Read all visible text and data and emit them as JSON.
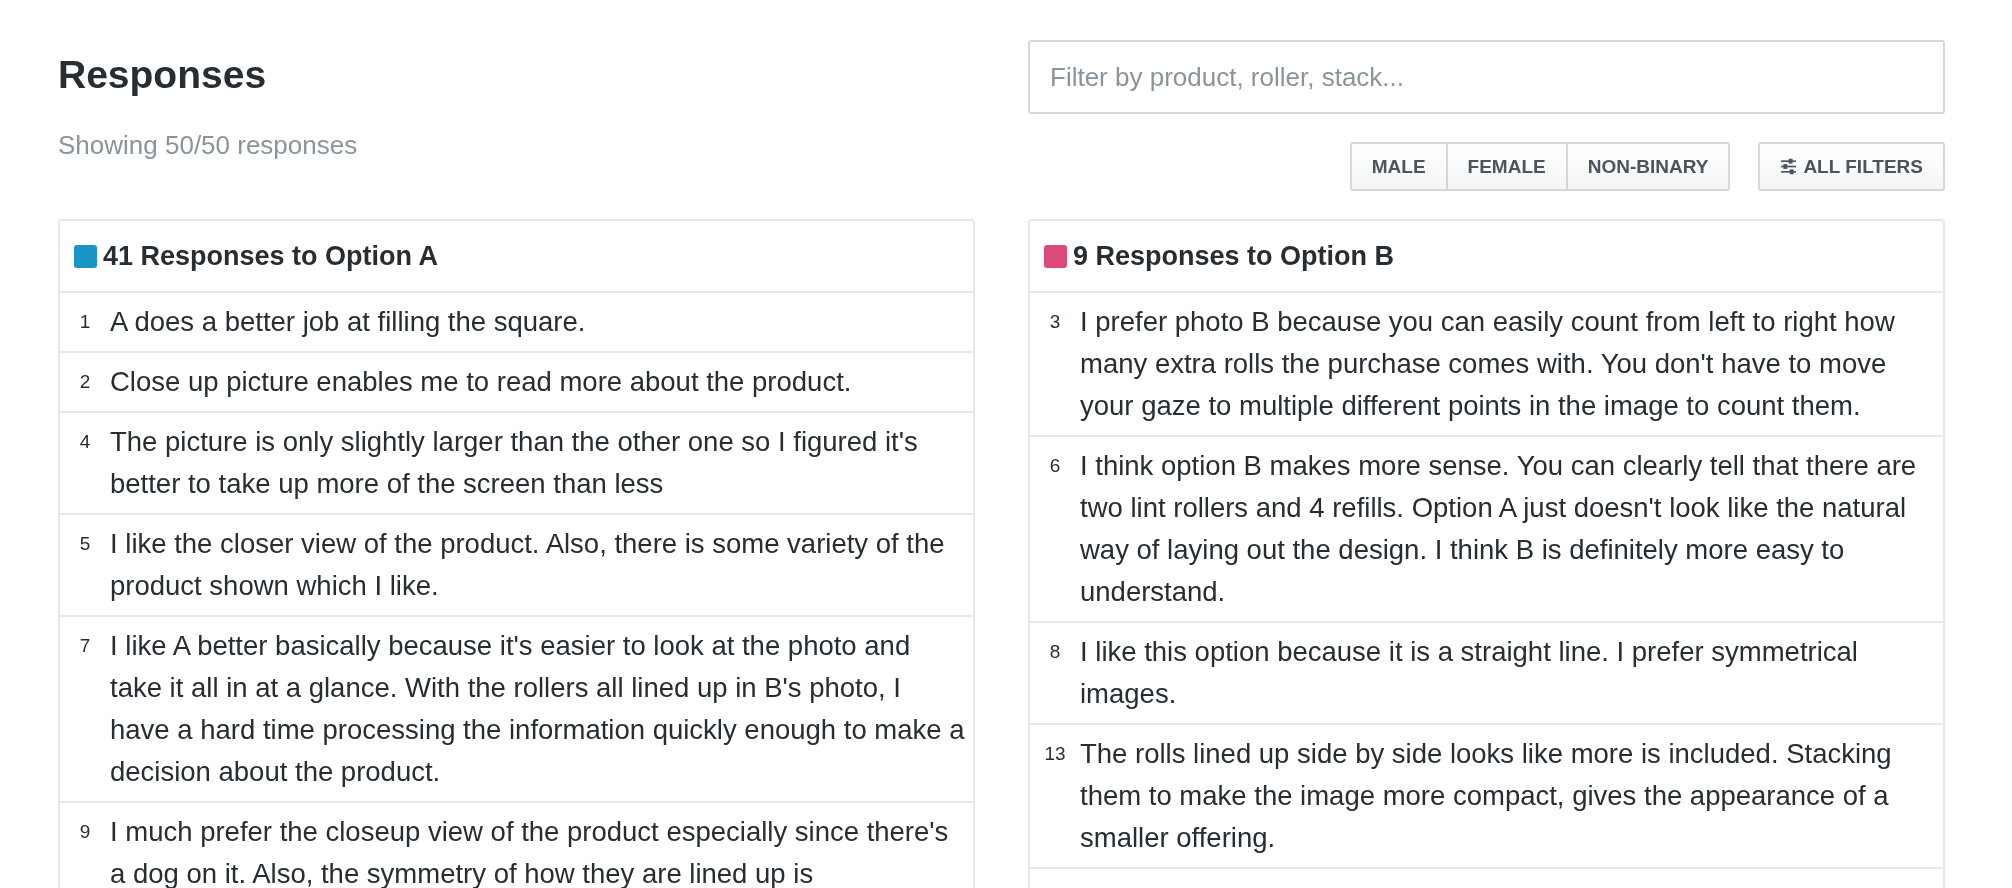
{
  "header": {
    "title": "Responses",
    "subtitle": "Showing 50/50 responses"
  },
  "search": {
    "placeholder": "Filter by product, roller, stack..."
  },
  "gender_filters": [
    {
      "label": "MALE",
      "selected": false
    },
    {
      "label": "FEMALE",
      "selected": false
    },
    {
      "label": "NON-BINARY",
      "selected": false
    }
  ],
  "all_filters_button": {
    "label": "ALL FILTERS"
  },
  "groups": [
    {
      "title": "41 Responses to Option A",
      "color": "#1a96c6",
      "responses": [
        {
          "number": "1",
          "text": "A does a better job at filling the square."
        },
        {
          "number": "2",
          "text": "Close up picture enables me to read more about the product."
        },
        {
          "number": "4",
          "text": "The picture is only slightly larger than the other one so I figured it's better to take up more of the screen than less"
        },
        {
          "number": "5",
          "text": "I like the closer view of the product. Also, there is some variety of the product shown which I like."
        },
        {
          "number": "7",
          "text": "I like A better basically because it's easier to look at the photo and take it all in at a glance. With the rollers all lined up in B's photo, I have a hard time processing the information quickly enough to make a decision about the product."
        },
        {
          "number": "9",
          "text": "I much prefer the closeup view of the product especially since there's a dog on it. Also, the symmetry of how they are lined up is"
        }
      ]
    },
    {
      "title": "9 Responses to Option B",
      "color": "#dc4a7c",
      "responses": [
        {
          "number": "3",
          "text": "I prefer photo B because you can easily count from left to right how many extra rolls the purchase comes with. You don't have to move your gaze to multiple different points in the image to count them."
        },
        {
          "number": "6",
          "text": "I think option B makes more sense. You can clearly tell that there are two lint rollers and 4 refills. Option A just doesn't look like the natural way of laying out the design. I think B is definitely more easy to understand."
        },
        {
          "number": "8",
          "text": "I like this option because it is a straight line. I prefer symmetrical images."
        },
        {
          "number": "13",
          "text": "The rolls lined up side by side looks like more is included. Stacking them to make the image more compact, gives the appearance of a smaller offering."
        }
      ]
    }
  ]
}
